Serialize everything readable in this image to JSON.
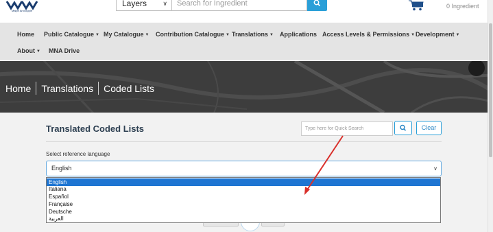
{
  "header": {
    "logo_caption": "Malplr And Apple",
    "category_select": "Layers",
    "search_placeholder": "Search for Ingredient",
    "cart_count": "0 Ingredient"
  },
  "nav": {
    "items": [
      {
        "label": "Home",
        "caret": false
      },
      {
        "label": "Public Catalogue",
        "caret": true
      },
      {
        "label": "My Catalogue",
        "caret": true
      },
      {
        "label": "Contribution Catalogue",
        "caret": true
      },
      {
        "label": "Translations",
        "caret": true
      },
      {
        "label": "Applications",
        "caret": false
      },
      {
        "label": "Access Levels & Permissions",
        "caret": true
      },
      {
        "label": "Development",
        "caret": true
      },
      {
        "label": "About",
        "caret": true
      },
      {
        "label": "MNA Drive",
        "caret": false
      }
    ]
  },
  "breadcrumb": [
    "Home",
    "Translations",
    "Coded Lists"
  ],
  "page": {
    "title": "Translated Coded Lists",
    "quick_search_placeholder": "Type here for Quick Search",
    "clear_label": "Clear",
    "select_label": "Select reference language",
    "selected_language": "English"
  },
  "dropdown": {
    "options": [
      "English",
      "Italiana",
      "Español",
      "Française",
      "Deutsche",
      "العربية"
    ],
    "highlighted_index": 0
  },
  "colors": {
    "accent": "#2a9fd8",
    "highlight": "#1e75d2",
    "nav_bg": "#e4e4e4",
    "arrow": "#d9302b"
  }
}
